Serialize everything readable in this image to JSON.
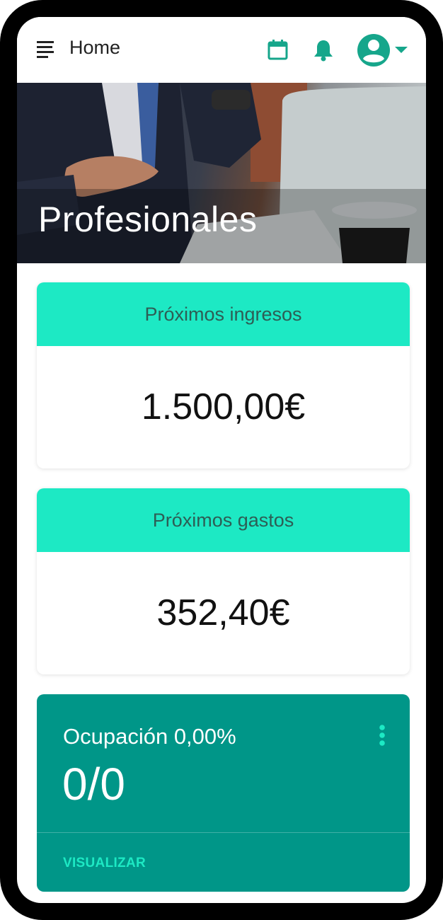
{
  "header": {
    "title": "Home",
    "icons": [
      "menu-icon",
      "calendar-icon",
      "bell-icon",
      "account-circle-icon",
      "caret-down-icon"
    ]
  },
  "hero": {
    "title": "Profesionales"
  },
  "cards": {
    "income": {
      "title": "Próximos ingresos",
      "value": "1.500,00€"
    },
    "expenses": {
      "title": "Próximos gastos",
      "value": "352,40€"
    }
  },
  "occupancy": {
    "label": "Ocupación 0,00%",
    "value": "0/0",
    "action": "VISUALIZAR"
  },
  "colors": {
    "accent": "#16a68b",
    "card_header": "#1de9c4",
    "occupancy_bg": "#009688"
  }
}
